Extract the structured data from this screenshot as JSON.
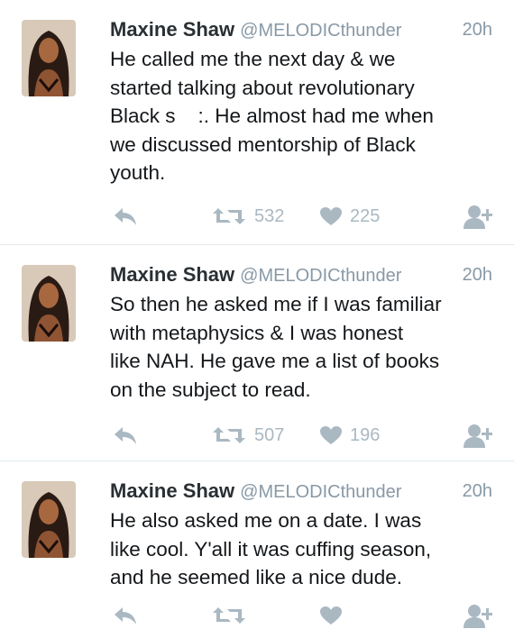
{
  "tweets": [
    {
      "name": "Maxine Shaw",
      "handle": "@MELODICthunder",
      "time": "20h",
      "text": "He called me the next day & we\nstarted talking about revolutionary\nBlack s    :. He almost had me when\nwe discussed mentorship of Black\nyouth.",
      "retweets": "532",
      "likes": "225"
    },
    {
      "name": "Maxine Shaw",
      "handle": "@MELODICthunder",
      "time": "20h",
      "text": "So then he asked me if I was familiar\nwith metaphysics & I was honest\nlike NAH. He gave me a list of books\non the subject to read.",
      "retweets": "507",
      "likes": "196"
    },
    {
      "name": "Maxine Shaw",
      "handle": "@MELODICthunder",
      "time": "20h",
      "text": "He also asked me on a date. I was\nlike cool. Y'all it was cuffing season,\nand he seemed like a nice dude.",
      "retweets": "",
      "likes": ""
    }
  ],
  "icons": {
    "reply": "reply-icon",
    "retweet": "retweet-icon",
    "like": "heart-icon",
    "follow": "follow-icon"
  },
  "colors": {
    "text": "#14171a",
    "secondary": "#8899a6",
    "action": "#aab8c2",
    "divider": "#e1e8ed"
  }
}
